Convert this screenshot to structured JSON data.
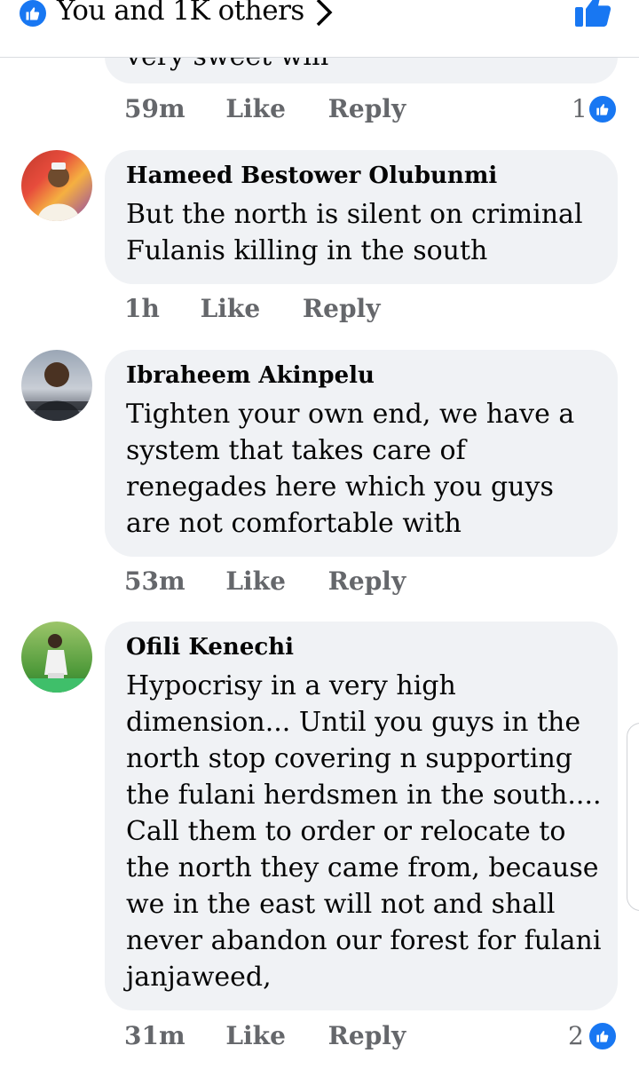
{
  "header": {
    "reactors_text": "You and 1K others"
  },
  "colors": {
    "accent": "#1877f2",
    "bubble": "#f0f2f5",
    "meta": "#65676b"
  },
  "partial_comment": {
    "text": "very sweet win",
    "time": "59m",
    "like_label": "Like",
    "reply_label": "Reply",
    "reaction_count": "1"
  },
  "comments": [
    {
      "author": "Hameed Bestower Olubunmi",
      "text": "But the north is silent on criminal Fulanis killing in the south",
      "time": "1h",
      "like_label": "Like",
      "reply_label": "Reply"
    },
    {
      "author": "Ibraheem Akinpelu",
      "text": "Tighten your own end, we have a system that takes care of renegades here which you guys are not comfortable with",
      "time": "53m",
      "like_label": "Like",
      "reply_label": "Reply"
    },
    {
      "author": "Ofili Kenechi",
      "text": "Hypocrisy in a very high dimension... Until you guys in the north stop covering n supporting the fulani herdsmen in the south.... Call them to order or relocate to the north they came from, because we in the east will not and shall never abandon our forest for fulani janjaweed,",
      "time": "31m",
      "like_label": "Like",
      "reply_label": "Reply",
      "reaction_count": "2"
    }
  ]
}
